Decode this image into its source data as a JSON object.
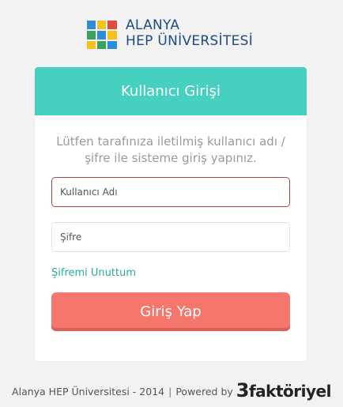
{
  "logo": {
    "line1": "ALANYA",
    "line2": "HEP ÜNİVERSİTESİ",
    "colors": {
      "text": "#1f4b82",
      "blue": "#2d8fd5",
      "yellow": "#f3c21b",
      "green": "#3aa15f",
      "red": "#e14b3f"
    }
  },
  "login": {
    "title": "Kullanıcı Girişi",
    "instructions": "Lütfen tarafınıza iletilmiş kullanıcı adı / şifre ile sisteme giriş yapınız.",
    "username_placeholder": "Kullanıcı Adı",
    "password_placeholder": "Şifre",
    "forgot_link": "Şifremi Unuttum",
    "submit_label": "Giriş Yap"
  },
  "footer": {
    "copyright": "Alanya HEP Üniversitesi - 2014",
    "separator": "|",
    "powered_by": "Powered by",
    "brand_number": "3",
    "brand_text": "faktöriyel"
  },
  "colors": {
    "header": "#47cfbf",
    "button": "#f4766c",
    "link": "#2aab9c",
    "focus_border": "#a94442"
  }
}
